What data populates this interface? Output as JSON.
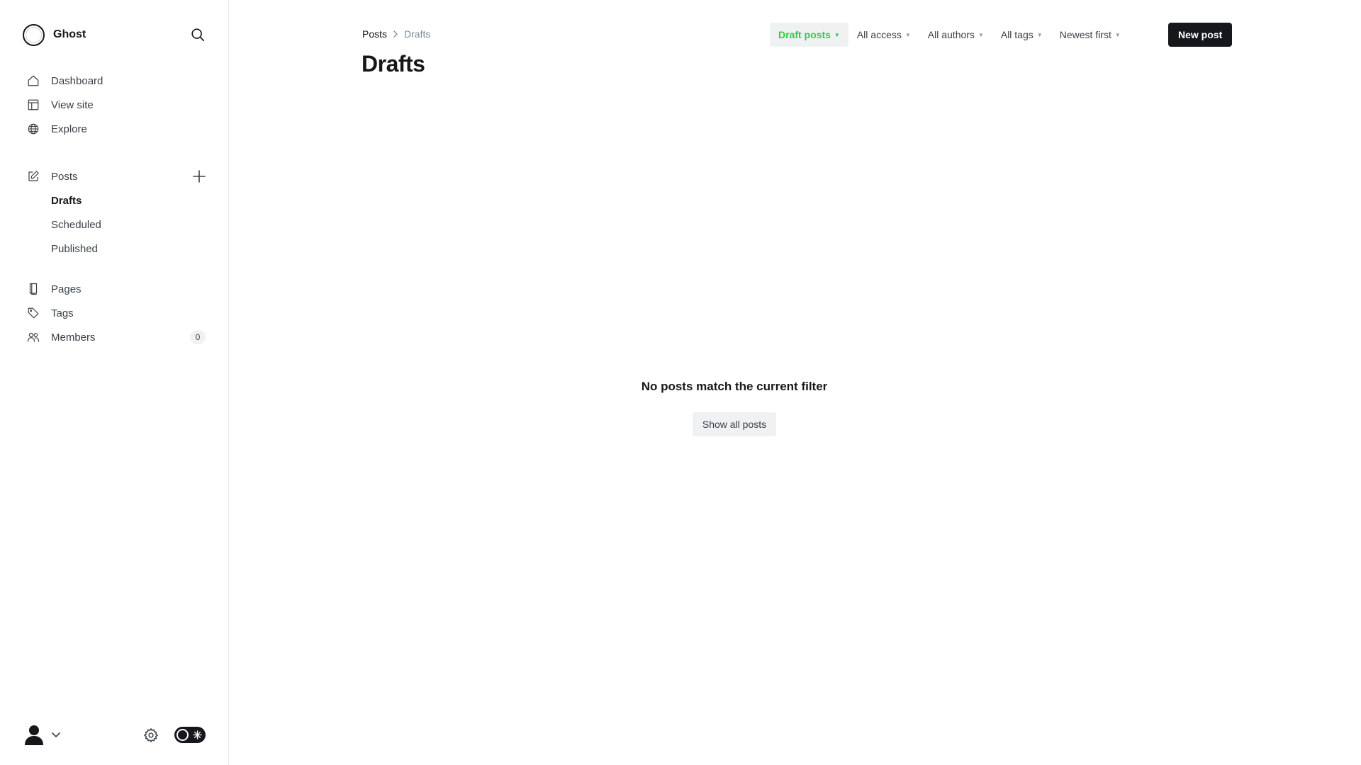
{
  "sidebar": {
    "brand_name": "Ghost",
    "nav_primary": [
      {
        "label": "Dashboard",
        "icon": "home-icon"
      },
      {
        "label": "View site",
        "icon": "layout-icon"
      },
      {
        "label": "Explore",
        "icon": "globe-icon"
      }
    ],
    "posts": {
      "label": "Posts",
      "icon": "pencil-square-icon",
      "sub_items": [
        {
          "label": "Drafts",
          "active": true
        },
        {
          "label": "Scheduled",
          "active": false
        },
        {
          "label": "Published",
          "active": false
        }
      ]
    },
    "nav_secondary": [
      {
        "label": "Pages",
        "icon": "page-icon"
      },
      {
        "label": "Tags",
        "icon": "tag-icon"
      },
      {
        "label": "Members",
        "icon": "users-icon",
        "count": "0"
      }
    ]
  },
  "header": {
    "breadcrumb": {
      "parent": "Posts",
      "current": "Drafts"
    },
    "title": "Drafts",
    "filters": [
      {
        "label": "Draft posts",
        "active": true
      },
      {
        "label": "All access",
        "active": false
      },
      {
        "label": "All authors",
        "active": false
      },
      {
        "label": "All tags",
        "active": false
      },
      {
        "label": "Newest first",
        "active": false
      }
    ],
    "new_post_label": "New post"
  },
  "empty_state": {
    "message": "No posts match the current filter",
    "button_label": "Show all posts"
  },
  "colors": {
    "accent_green": "#30cf43",
    "primary_dark": "#15171a",
    "muted_bg": "#eff1f3"
  }
}
